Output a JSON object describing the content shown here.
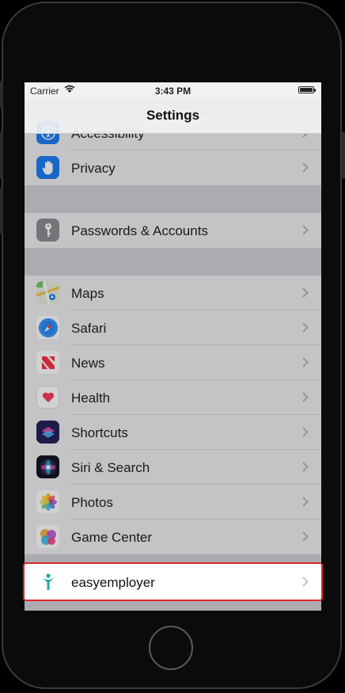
{
  "status_bar": {
    "carrier": "Carrier",
    "time": "3:43 PM"
  },
  "nav": {
    "title": "Settings"
  },
  "partial_row": {
    "label": "Accessibility"
  },
  "group1": [
    {
      "label": "Privacy",
      "icon": "hand-icon",
      "color": "#1e7ef5"
    }
  ],
  "group2": [
    {
      "label": "Passwords & Accounts",
      "icon": "key-icon",
      "color": "#8e8e93"
    }
  ],
  "group3": [
    {
      "label": "Maps",
      "icon": "maps-icon",
      "color": "#7ac36a"
    },
    {
      "label": "Safari",
      "icon": "compass-icon",
      "color": "#1e7ef5"
    },
    {
      "label": "News",
      "icon": "news-icon",
      "color": "#ffffff"
    },
    {
      "label": "Health",
      "icon": "heart-icon",
      "color": "#ffffff"
    },
    {
      "label": "Shortcuts",
      "icon": "shortcuts-icon",
      "color": "#2a2a6b"
    },
    {
      "label": "Siri & Search",
      "icon": "siri-icon",
      "color": "#202030"
    },
    {
      "label": "Photos",
      "icon": "photos-icon",
      "color": "#ffffff"
    },
    {
      "label": "Game Center",
      "icon": "game-center-icon",
      "color": "#ffffff"
    }
  ],
  "highlighted_app": {
    "label": "easyemployer",
    "icon": "easyemployer-logo-icon",
    "color": "#1ba9a9"
  },
  "colors": {
    "highlight_border": "#e0262c",
    "accent": "#1e7ef5"
  }
}
